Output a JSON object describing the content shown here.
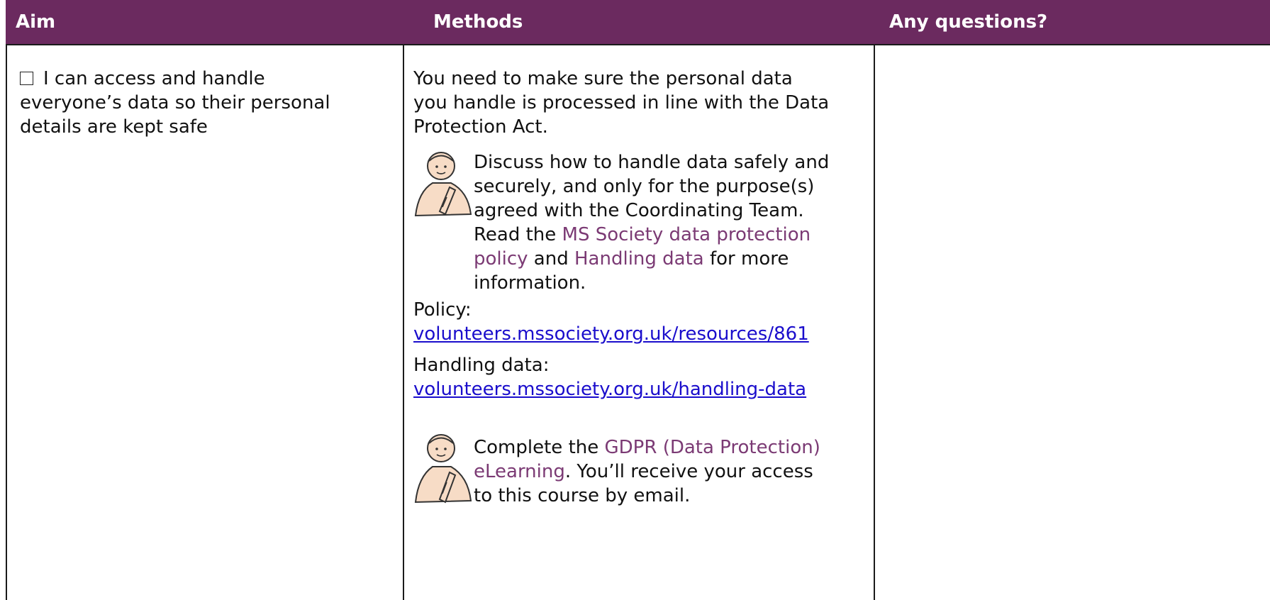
{
  "header": {
    "aim": "Aim",
    "methods": "Methods",
    "questions": "Any questions?"
  },
  "aim": {
    "text_line1": "I can access and handle",
    "text_line2": "everyone’s data so their personal",
    "text_line3": "details are kept safe"
  },
  "methods": {
    "intro_line1": "You need to make sure the personal data",
    "intro_line2": "you handle is processed in line with the Data",
    "intro_line3": "Protection Act.",
    "discuss_line1": "Discuss how to handle data safely and",
    "discuss_line2": "securely, and only for the purpose(s)",
    "discuss_line3": "agreed with the Coordinating Team.",
    "read_prefix": "Read the ",
    "policy_link_part1": "MS Society data protection",
    "policy_link_part2": "policy",
    "and": " and ",
    "handling_link": "Handling data",
    "for_more": " for more",
    "information": "information.",
    "policy_label": "Policy:",
    "policy_url": "volunteers.mssociety.org.uk/resources/861",
    "handling_label": "Handling data:",
    "handling_url": "volunteers.mssociety.org.uk/handling-data",
    "complete_prefix": "Complete the ",
    "gdpr_link_part1": "GDPR (Data Protection)",
    "gdpr_link_part2": "eLearning",
    "receive": ". You’ll receive your access",
    "course": "to this course by email."
  },
  "icons": {
    "thinking_person": "thinking-person-icon",
    "checkbox": "checkbox-icon"
  },
  "colors": {
    "header_bg": "#6b2a5f",
    "header_text": "#ffffff",
    "link_blue": "#1a0dcc",
    "link_purple": "#7b3a74"
  }
}
